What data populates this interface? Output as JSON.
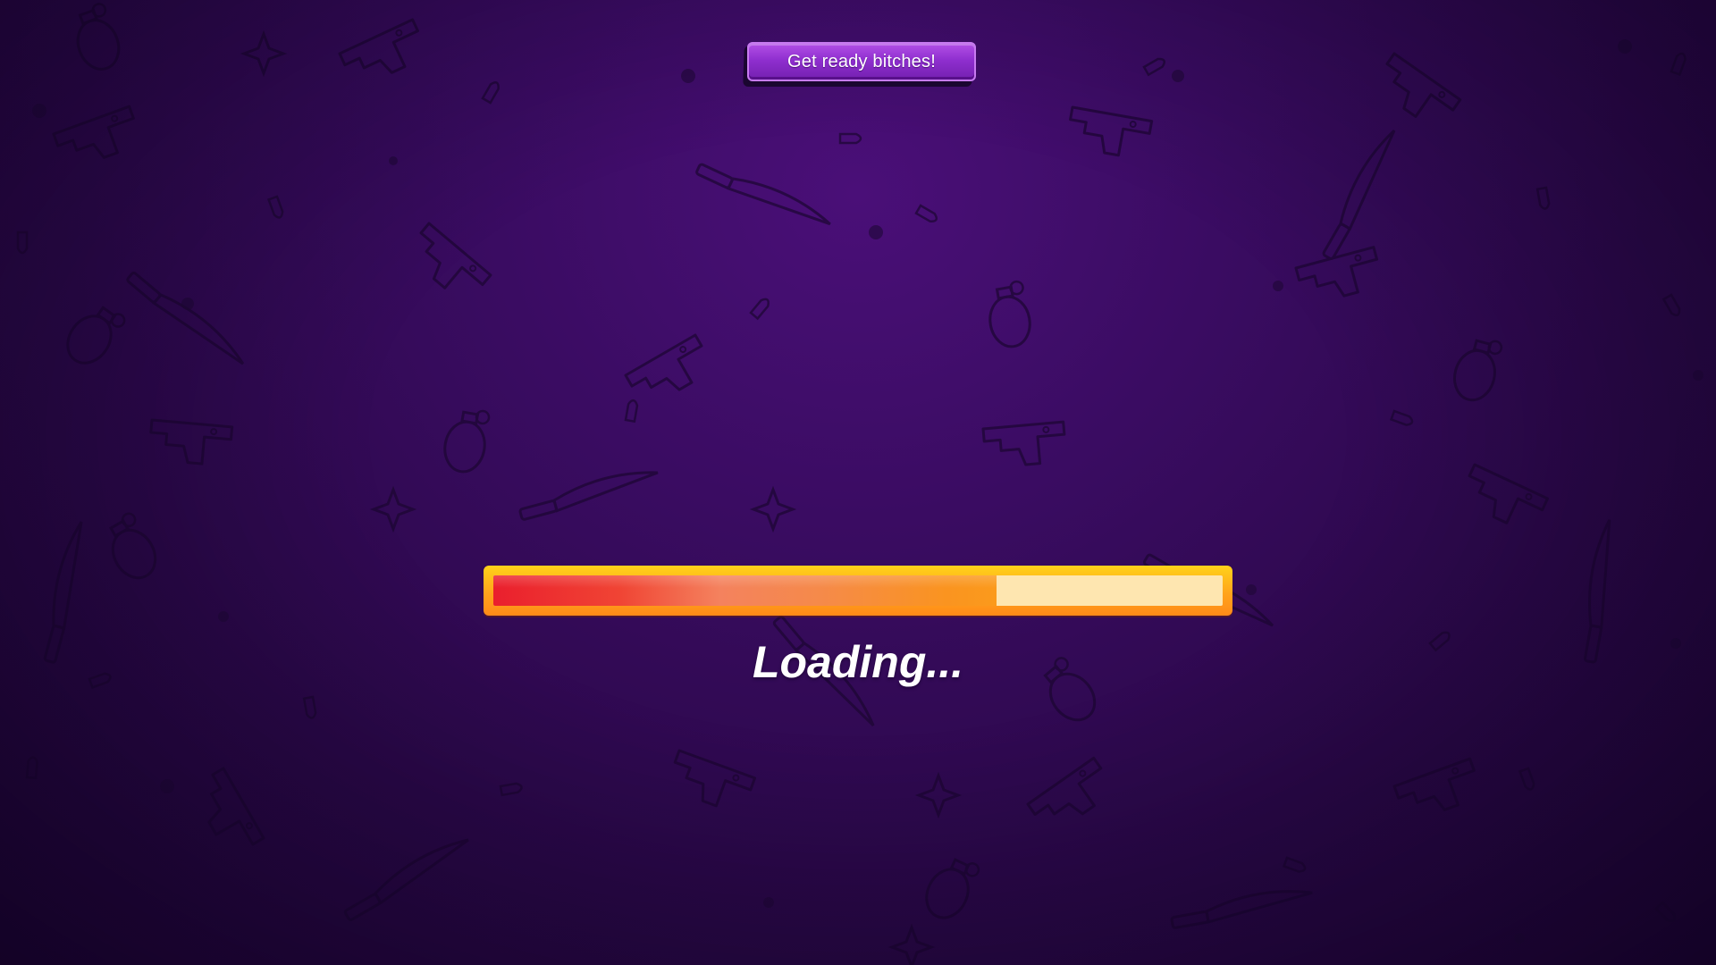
{
  "banner": {
    "text": "Get ready bitches!"
  },
  "loading": {
    "label": "Loading...",
    "progress": 0.69
  },
  "colors": {
    "background": "#3a0c62",
    "banner": "#8f2fcf",
    "frame": "#ffc21a",
    "track": "#fee6b0",
    "fill_start": "#ea1f2d",
    "fill_end": "#fb9a1c"
  },
  "background": {
    "pattern": "weapon-doodles"
  }
}
